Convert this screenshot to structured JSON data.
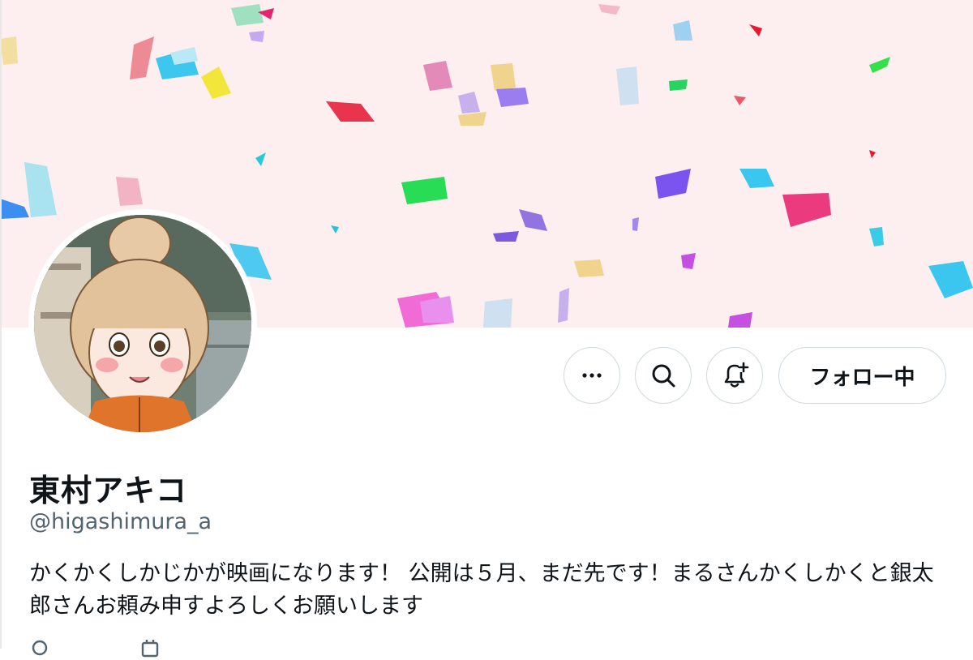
{
  "profile": {
    "display_name": "東村アキコ",
    "handle": "@higashimura_a",
    "bio": "かくかくしかじかが映画になります！ 公開は５月、まだ先です！まるさんかくしかくと銀太郎さんお頼み申すよろしくお願いします"
  },
  "actions": {
    "more_icon": "more-horizontal-icon",
    "search_icon": "search-icon",
    "notify_icon": "bell-plus-icon",
    "follow_label": "フォロー中"
  },
  "colors": {
    "banner_bg": "#fdeef0",
    "border": "#cfd9de",
    "text_primary": "#0f1419",
    "text_secondary": "#536471"
  }
}
